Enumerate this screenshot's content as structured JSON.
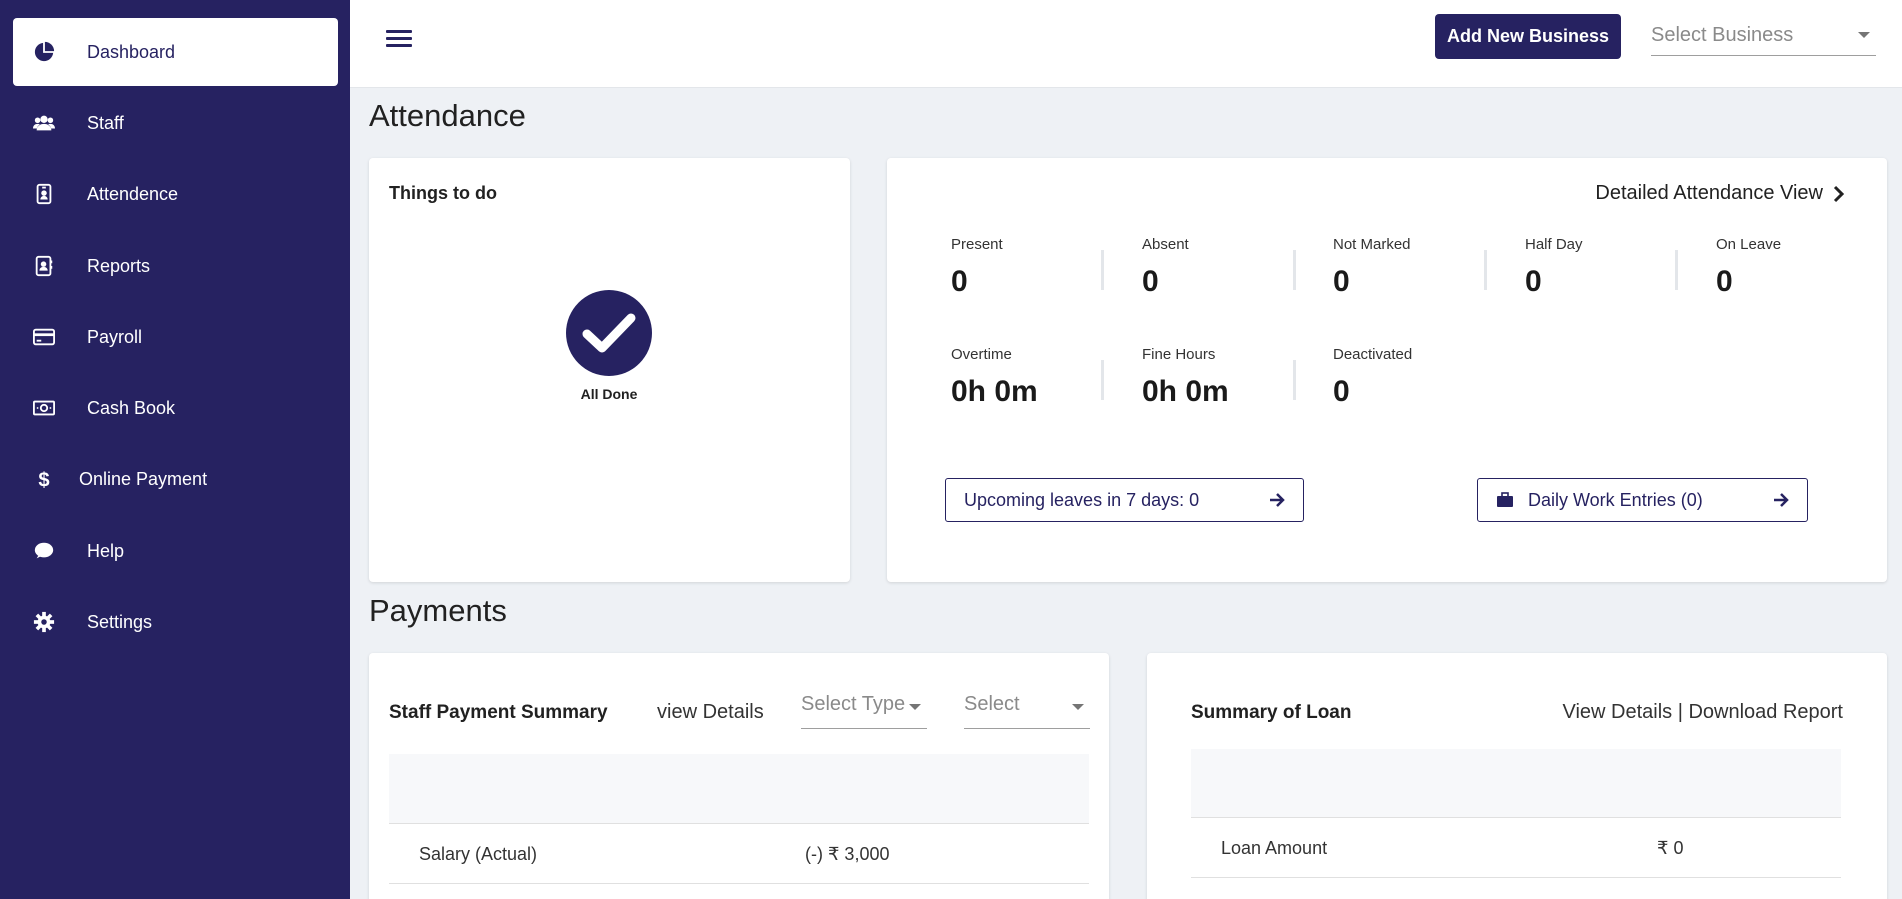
{
  "sidebar": {
    "items": [
      {
        "label": "Dashboard",
        "icon": "pie-chart-icon",
        "active": true
      },
      {
        "label": "Staff",
        "icon": "users-icon"
      },
      {
        "label": "Attendence",
        "icon": "id-badge-icon"
      },
      {
        "label": "Reports",
        "icon": "contact-book-icon"
      },
      {
        "label": "Payroll",
        "icon": "credit-card-icon"
      },
      {
        "label": "Cash Book",
        "icon": "money-bill-icon"
      },
      {
        "label": "Online Payment",
        "icon": "dollar-icon"
      },
      {
        "label": "Help",
        "icon": "chat-bubble-icon"
      },
      {
        "label": "Settings",
        "icon": "gear-icon"
      }
    ]
  },
  "topbar": {
    "add_business_label": "Add New Business",
    "select_business_placeholder": "Select Business"
  },
  "attendance": {
    "section_title": "Attendance",
    "todo": {
      "title": "Things to do",
      "status": "All Done"
    },
    "detail_link": "Detailed Attendance View",
    "stats_row1": [
      {
        "label": "Present",
        "value": "0"
      },
      {
        "label": "Absent",
        "value": "0"
      },
      {
        "label": "Not Marked",
        "value": "0"
      },
      {
        "label": "Half Day",
        "value": "0"
      },
      {
        "label": "On Leave",
        "value": "0"
      }
    ],
    "stats_row2": [
      {
        "label": "Overtime",
        "value": "0h 0m"
      },
      {
        "label": "Fine Hours",
        "value": "0h 0m"
      },
      {
        "label": "Deactivated",
        "value": "0"
      }
    ],
    "upcoming_leaves": "Upcoming leaves in 7 days: 0",
    "daily_work": "Daily Work Entries (0)"
  },
  "payments": {
    "section_title": "Payments",
    "staff_summary": {
      "title": "Staff Payment Summary",
      "view_details": "view Details",
      "select_type": "Select Type",
      "select": "Select",
      "rows": [
        {
          "label": "Salary (Actual)",
          "value": "(-) ₹ 3,000"
        }
      ]
    },
    "loan_summary": {
      "title": "Summary of Loan",
      "links": "View Details | Download Report",
      "rows": [
        {
          "label": "Loan Amount",
          "value": "₹ 0"
        }
      ]
    }
  },
  "colors": {
    "brand": "#262261",
    "background": "#eef1f5"
  }
}
